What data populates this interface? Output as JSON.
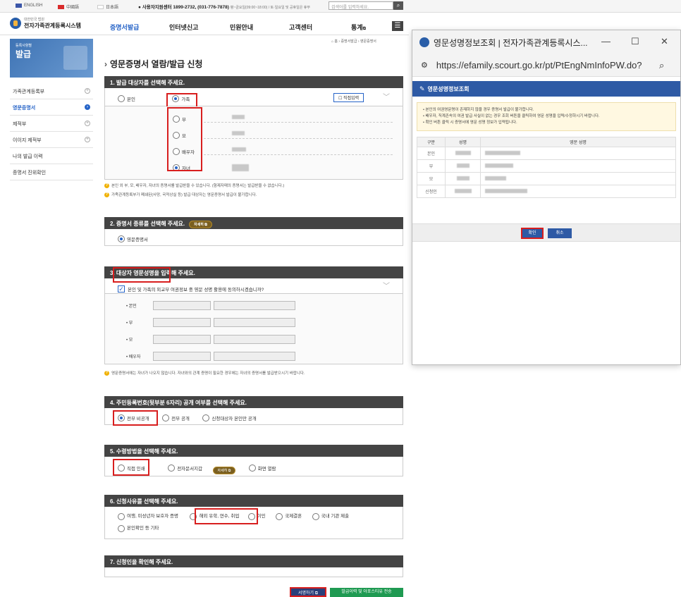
{
  "topbar": {
    "langs": [
      "ENGLISH",
      "中國語",
      "日本語"
    ],
    "callcenter": "사용자지원센터 1899-2732, (031-776-7878)",
    "call_note": "평~금요일(09:00~18:00) / 토·일요일 및 공휴일은 휴무",
    "search_placeholder": "검색어를 입력하세요."
  },
  "header": {
    "logo_sub": "대한민국 법원",
    "logo_title": "전자가족관계등록시스템",
    "gnb": [
      "증명서발급",
      "인터넷신고",
      "민원안내",
      "고객센터",
      "통계"
    ],
    "gnb_ext": "⧉"
  },
  "leftnav": {
    "banner_sub": "등록사항별",
    "banner_title": "발급",
    "items": [
      "가족관계등록부",
      "영문증명서",
      "제적부",
      "이이지 제적부",
      "나의 발급 이력",
      "증명서 진위확인"
    ]
  },
  "breadcrumb": "⌂ 홈 › 증명서발급 › 영문증명서",
  "page_title": "영문증명서 열람/발급 신청",
  "sec1": {
    "title": "1. 발급 대상자를 선택해 주세요.",
    "opt_self": "본인",
    "opt_family": "가족",
    "direct_input": "직접입력",
    "members": [
      "부",
      "모",
      "배우자",
      "자녀"
    ],
    "hint1": "본인 외 부, 모, 배우자, 자녀의 증명서를 발급받을 수 있습니다. (형제자매의 증명서는 발급받을 수 없습니다.)",
    "hint2": "가족관계등록부가 폐쇄된(사망, 국적상실 등) 발급 대상자는 영문증명서 발급이 불가합니다."
  },
  "sec2": {
    "title": "2. 증명서 종류를 선택해 주세요.",
    "detail_btn": "자세히 ⧉",
    "option": "영문증명서"
  },
  "sec3": {
    "title": "3. 대상자 영문성명을 입력해 주세요.",
    "consent": "본인 및 가족의 외교부 여권정보 중 영문 성명 활용에 동의하시겠습니까?",
    "rows": [
      "본인",
      "부",
      "모",
      "배우자"
    ],
    "hint": "영문증명서에는 자녀가 나오지 않습니다. 자녀와의 관계 증명이 필요한 경우에는 자녀의 증명서를 발급받으시기 바랍니다."
  },
  "sec4": {
    "title": "4. 주민등록번호(뒷부분 6자리) 공개 여부를 선택해 주세요.",
    "options": [
      "전부 비공개",
      "전부 공개",
      "신청대상자 본인만 공개"
    ]
  },
  "sec5": {
    "title": "5. 수령방법을 선택해 주세요.",
    "options": [
      "직접 인쇄",
      "전자문서지갑",
      "화면 열람"
    ],
    "detail_btn": "자세히 ⧉"
  },
  "sec6": {
    "title": "6. 신청사유를 선택해 주세요.",
    "options": [
      "여행, 미성년자 보호자 증명",
      "해외 유학, 연수, 취업",
      "이민",
      "국제결혼",
      "국내 기관 제출",
      "본인확인 등 기타"
    ]
  },
  "sec7": {
    "title": "7. 신청인을 확인해 주세요."
  },
  "bottom_buttons": {
    "sample": "서명하기 ⧉",
    "submit": "발급이력 및 아포스티유 전송"
  },
  "popup": {
    "window_title": "영문성명정보조회 | 전자가족관계등록시스...",
    "url": "https://efamily.scourt.go.kr/pt/PtEngNmInfoPW.do?",
    "head": "영문성명정보조회",
    "notices": [
      "본인의 여권영문명이 존재하지 않을 경우 증명서 발급이 불가합니다.",
      "배우자, 직계존속의 여권 발급 사실이 없는 경우 조회 버튼을 클릭하여 영문 성명을 입력/수정하시기 바랍니다.",
      "확인 버튼 클릭 시 증명서에 영문 성명 정보가 입력됩니다."
    ],
    "col_kind": "구분",
    "col_name": "성명",
    "col_eng": "영문 성명",
    "rows": [
      "본인",
      "부",
      "모",
      "신청인"
    ],
    "ok": "확인",
    "cancel": "취소"
  },
  "colors": {
    "accent": "#2563c7",
    "dark_header": "#444444",
    "highlight": "#d81e1e",
    "popup_head": "#2e5aa5",
    "green": "#1f9a52"
  }
}
